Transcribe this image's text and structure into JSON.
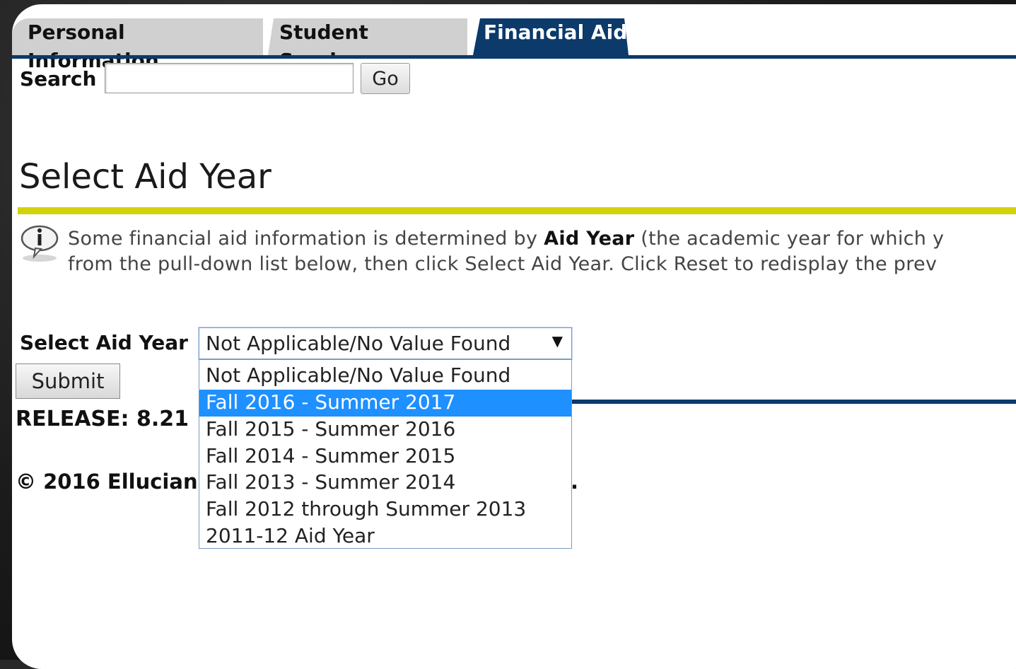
{
  "tabs": [
    {
      "label": "Personal Information",
      "active": false
    },
    {
      "label": "Student Services",
      "active": false
    },
    {
      "label": "Financial Aid",
      "active": true
    }
  ],
  "colors": {
    "tab_active": "#0b3a6b",
    "tab_inactive": "#d0d0d0",
    "accent_rule": "#d2d20a",
    "selected_option": "#1e90ff"
  },
  "search": {
    "label": "Search",
    "value": "",
    "go_label": "Go"
  },
  "page_title": "Select Aid Year",
  "info": {
    "icon": "info-speech-bubble-icon",
    "line1_before": "Some financial aid information is determined by ",
    "line1_bold": "Aid Year",
    "line1_after": " (the academic year for which y",
    "line2": "from the pull-down list below, then click Select Aid Year. Click Reset to redisplay the prev"
  },
  "aid_year_select": {
    "label": "Select Aid Year",
    "current_value": "Not Applicable/No Value Found",
    "arrow": "▼",
    "options": [
      "Not Applicable/No Value Found",
      "Fall 2016 - Summer 2017",
      "Fall 2015 - Summer 2016",
      "Fall 2014 - Summer 2015",
      "Fall 2013 - Summer 2014",
      "Fall 2012 through Summer 2013",
      "2011-12 Aid Year"
    ],
    "highlighted_index": 1
  },
  "submit_label": "Submit",
  "footer": {
    "release": "RELEASE: 8.21",
    "copyright": "© 2016 Ellucian",
    "trailing": "."
  }
}
